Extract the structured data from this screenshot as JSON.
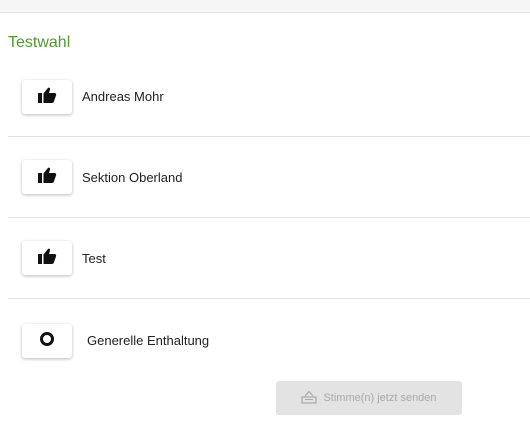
{
  "section": {
    "title": "Testwahl"
  },
  "options": [
    {
      "label": "Andreas Mohr",
      "icon": "thumbs-up-icon"
    },
    {
      "label": "Sektion Oberland",
      "icon": "thumbs-up-icon"
    },
    {
      "label": "Test",
      "icon": "thumbs-up-icon"
    },
    {
      "label": "Generelle Enthaltung",
      "icon": "circle-outline-icon"
    }
  ],
  "submit": {
    "label": "Stimme(n) jetzt senden",
    "icon": "ballot-box-icon",
    "disabled": true
  },
  "colors": {
    "accent": "#4f9a2f",
    "disabled_bg": "#e3e3e3",
    "disabled_text": "#a9a9a9"
  }
}
